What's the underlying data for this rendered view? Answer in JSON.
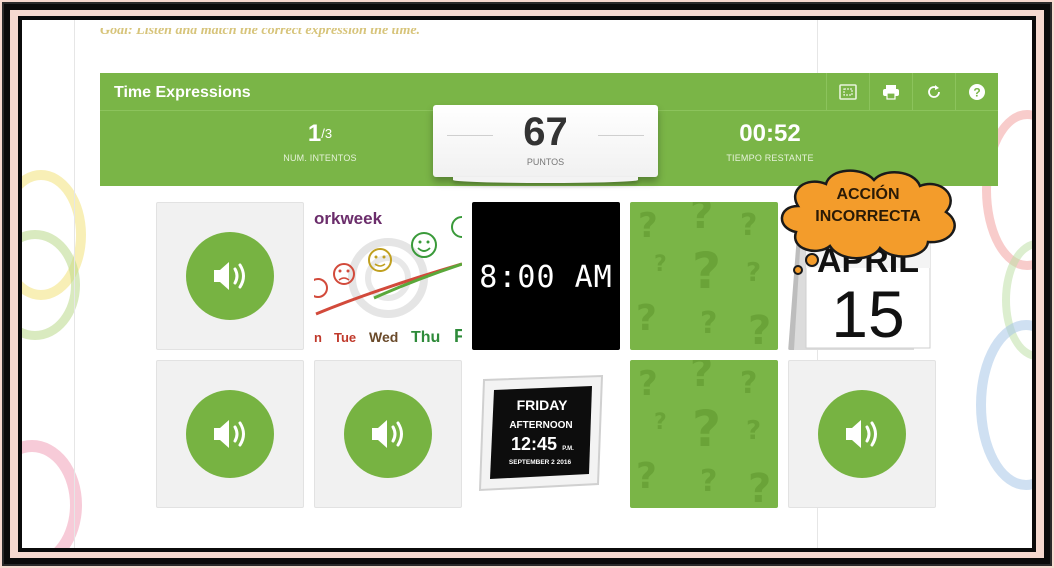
{
  "goal_text": "Goal: Listen and match the correct expression the time.",
  "game": {
    "title": "Time Expressions",
    "toolbar": [
      {
        "name": "fullscreen-icon"
      },
      {
        "name": "print-icon"
      },
      {
        "name": "restart-icon"
      },
      {
        "name": "help-icon"
      }
    ],
    "attempts": {
      "value": "1",
      "total": "/3",
      "label": "NUM. INTENTOS"
    },
    "score": {
      "value": "67",
      "label": "PUNTOS"
    },
    "time": {
      "value": "00:52",
      "label": "TIEMPO RESTANTE"
    }
  },
  "cards": {
    "workweek": {
      "title": "orkweek",
      "days": [
        "n",
        "Tue",
        "Wed",
        "Thu",
        "F"
      ]
    },
    "clock": {
      "text": "8:00 AM"
    },
    "digital_frame": {
      "day": "FRIDAY",
      "period": "AFTERNOON",
      "time": "12:45",
      "ampm": "P.M.",
      "date": "SEPTEMBER  2  2016"
    },
    "calendar": {
      "month": "APRIL",
      "day": "15"
    }
  },
  "feedback": {
    "line1": "ACCIÓN",
    "line2": "INCORRECTA"
  },
  "colors": {
    "green": "#7ab547",
    "speaker_green": "#77b342",
    "cloud_orange": "#f39c2b",
    "background_pink": "#f6d9cf"
  }
}
